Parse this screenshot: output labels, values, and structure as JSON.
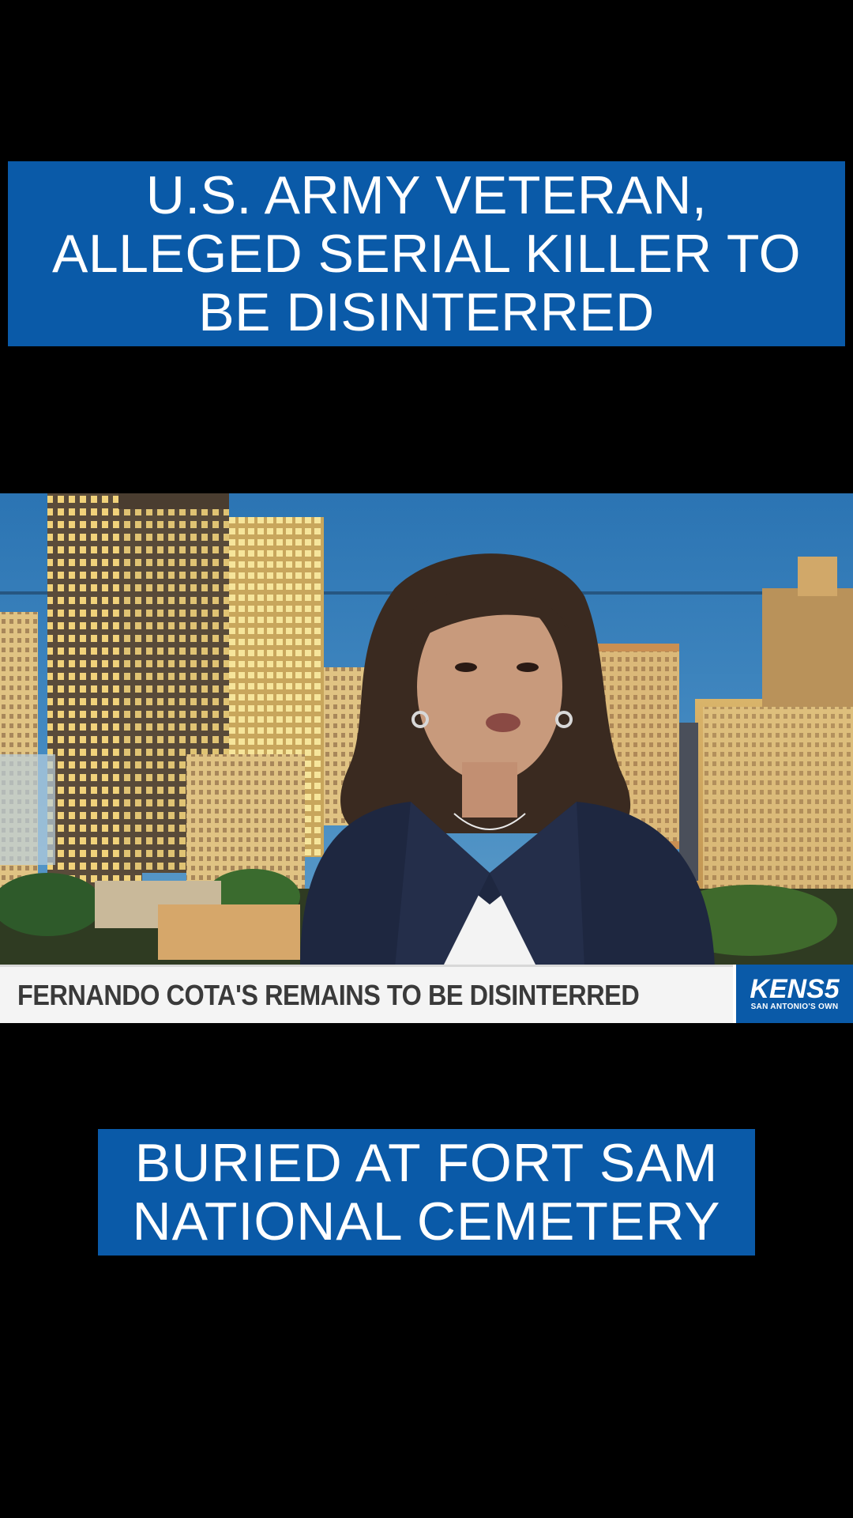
{
  "caption_top": {
    "lines": [
      "U.S. ARMY VETERAN,",
      "ALLEGED SERIAL KILLER TO",
      "BE DISINTERRED"
    ]
  },
  "video": {
    "lower_third": {
      "headline": "FERNANDO COTA'S REMAINS TO BE DISINTERRED",
      "logo_brand": "KENS5",
      "logo_tagline": "SAN ANTONIO'S OWN"
    }
  },
  "caption_bottom": {
    "lines": [
      "BURIED AT FORT SAM",
      "NATIONAL CEMETERY"
    ]
  },
  "colors": {
    "caption_bg": "#0a5aa8",
    "caption_text": "#ffffff",
    "page_bg": "#000000",
    "lower_third_bg": "#f4f4f4",
    "lower_third_text": "#3a3a3a"
  }
}
